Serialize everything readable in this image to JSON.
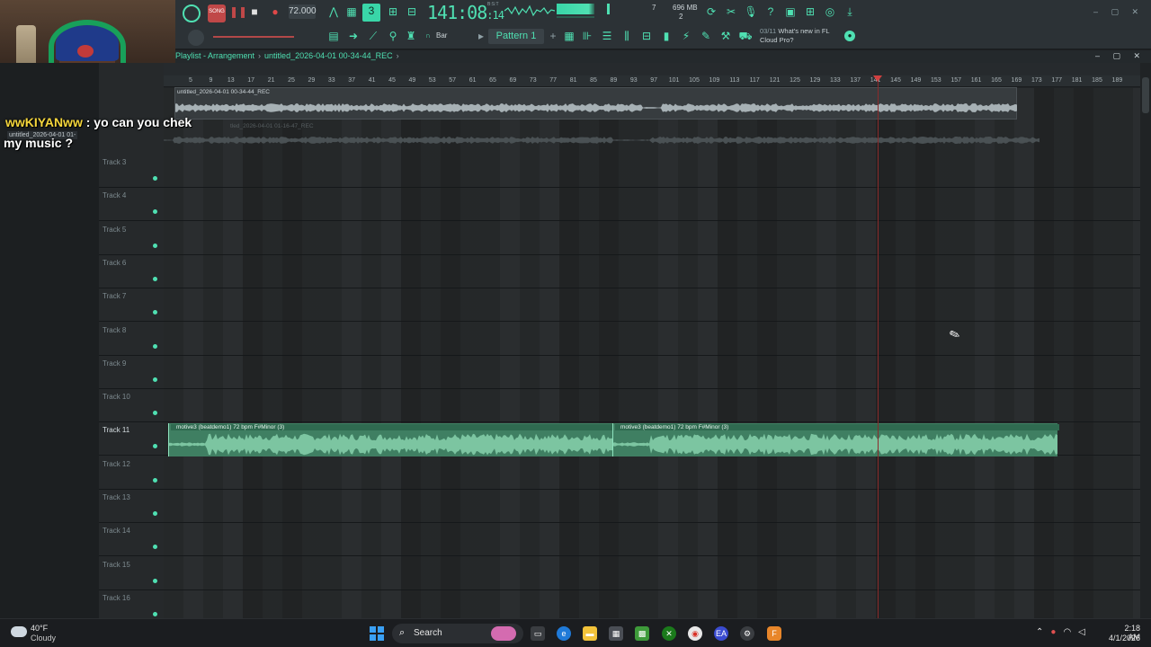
{
  "overlay": {
    "chat_user": "wwKIYANww",
    "chat_message_1": " : yo can you chek",
    "chat_message_2": "my music ?",
    "left_file_label": "untitled_2026-04-01 01-"
  },
  "toolbar": {
    "tempo": "72.000",
    "time": "141:08",
    "time_small": ":14",
    "bst_label": "B:S:T",
    "memory": "696 MB",
    "cpu_top": "7",
    "cpu_bottom": "2",
    "snap": "Bar",
    "pattern": "Pattern 1",
    "news_date": "03/11",
    "news_text_1": "What's new in FL",
    "news_text_2": "Cloud Pro?"
  },
  "playlist": {
    "title": "Playlist - Arrangement",
    "breadcrumb": "untitled_2026-04-01 00-34-44_REC",
    "ruler": [
      "5",
      "9",
      "13",
      "17",
      "21",
      "25",
      "29",
      "33",
      "37",
      "41",
      "45",
      "49",
      "53",
      "57",
      "61",
      "65",
      "69",
      "73",
      "77",
      "81",
      "85",
      "89",
      "93",
      "97",
      "101",
      "105",
      "109",
      "113",
      "117",
      "121",
      "125",
      "129",
      "133",
      "137",
      "141",
      "145",
      "149",
      "153",
      "157",
      "161",
      "165",
      "169",
      "173",
      "177",
      "181",
      "185",
      "189"
    ],
    "tracks": [
      "Track 3",
      "Track 4",
      "Track 5",
      "Track 6",
      "Track 7",
      "Track 8",
      "Track 9",
      "Track 10",
      "Track 11",
      "Track 12",
      "Track 13",
      "Track 14",
      "Track 15",
      "Track 16"
    ],
    "active_track": "Track 11",
    "rec_clip_1_label": "untitled_2026-04-01 00-34-44_REC",
    "rec_clip_2_label": "tled_2026-04-01 01-16-47_REC",
    "music_clip_label_1": "motive3 (beatdemo1) 72 bpm F#Minor (3)",
    "music_clip_label_2": "motive3 (beatdemo1) 72 bpm F#Minor (3)"
  },
  "taskbar": {
    "temperature": "40°F",
    "weather": "Cloudy",
    "search_label": "Search",
    "time": "2:18 AM",
    "date": "4/1/2026"
  },
  "colors": {
    "accent": "#4fe0b2",
    "clip_green": "#3f7f62",
    "playhead": "#8a2b2b"
  }
}
